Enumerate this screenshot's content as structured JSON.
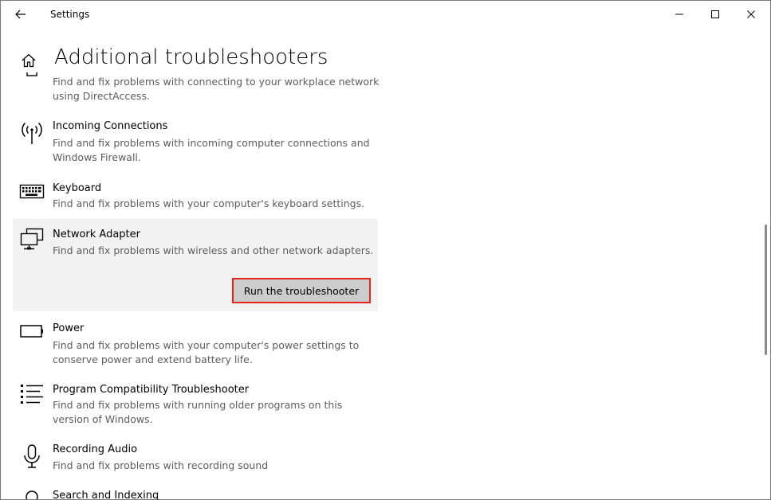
{
  "window": {
    "title": "Settings"
  },
  "header": {
    "title": "Additional troubleshooters"
  },
  "items": [
    {
      "title": "",
      "desc": "Find and fix problems with connecting to your workplace network using DirectAccess.",
      "icon": "directaccess-icon"
    },
    {
      "title": "Incoming Connections",
      "desc": "Find and fix problems with incoming computer connections and Windows Firewall.",
      "icon": "antenna-icon"
    },
    {
      "title": "Keyboard",
      "desc": "Find and fix problems with your computer's keyboard settings.",
      "icon": "keyboard-icon"
    },
    {
      "title": "Network Adapter",
      "desc": "Find and fix problems with wireless and other network adapters.",
      "icon": "network-adapter-icon",
      "button": "Run the troubleshooter"
    },
    {
      "title": "Power",
      "desc": "Find and fix problems with your computer's power settings to conserve power and extend battery life.",
      "icon": "battery-icon"
    },
    {
      "title": "Program Compatibility Troubleshooter",
      "desc": "Find and fix problems with running older programs on this version of Windows.",
      "icon": "list-icon"
    },
    {
      "title": "Recording Audio",
      "desc": "Find and fix problems with recording sound",
      "icon": "microphone-icon"
    },
    {
      "title": "Search and Indexing",
      "desc": "",
      "icon": "search-icon"
    }
  ],
  "colors": {
    "selected_bg": "#f2f2f2",
    "button_bg": "#cccccc",
    "highlight_border": "#e1251b",
    "desc_text": "#5d5d5d"
  }
}
